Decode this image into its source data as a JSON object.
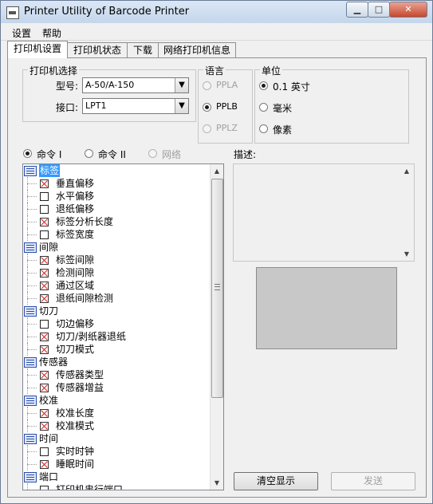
{
  "window": {
    "title": "Printer Utility of Barcode Printer",
    "minimize_glyph": "▁",
    "maximize_glyph": "□",
    "close_glyph": "✕"
  },
  "menu": {
    "items": [
      "设置",
      "帮助"
    ]
  },
  "tabs": [
    {
      "label": "打印机设置",
      "active": true
    },
    {
      "label": "打印机状态",
      "active": false
    },
    {
      "label": "下载",
      "active": false
    },
    {
      "label": "网络打印机信息",
      "active": false
    }
  ],
  "printer_select": {
    "title": "打印机选择",
    "model_label": "型号:",
    "model_value": "A-50/A-150",
    "port_label": "接口:",
    "port_value": "LPT1",
    "dropdown_glyph": "▼"
  },
  "language": {
    "title": "语言",
    "options": [
      {
        "label": "PPLA",
        "selected": false,
        "enabled": false
      },
      {
        "label": "PPLB",
        "selected": true,
        "enabled": true
      },
      {
        "label": "PPLZ",
        "selected": false,
        "enabled": false
      }
    ]
  },
  "unit": {
    "title": "单位",
    "options": [
      {
        "label": "0.1 英寸",
        "selected": true
      },
      {
        "label": "毫米",
        "selected": false
      },
      {
        "label": "像素",
        "selected": false
      }
    ]
  },
  "command_mode": {
    "options": [
      {
        "label": "命令 I",
        "selected": true,
        "enabled": true
      },
      {
        "label": "命令 II",
        "selected": false,
        "enabled": true
      },
      {
        "label": "网络",
        "selected": false,
        "enabled": false
      }
    ]
  },
  "description_label": "描述:",
  "scroll": {
    "up": "▲",
    "down": "▼"
  },
  "tree": [
    {
      "label": "标签",
      "selected": true,
      "children": [
        {
          "label": "垂直偏移",
          "checked": true
        },
        {
          "label": "水平偏移",
          "checked": false
        },
        {
          "label": "退纸偏移",
          "checked": false
        },
        {
          "label": "标签分析长度",
          "checked": true
        },
        {
          "label": "标签宽度",
          "checked": false
        }
      ]
    },
    {
      "label": "间隙",
      "selected": false,
      "children": [
        {
          "label": "标签间隙",
          "checked": true
        },
        {
          "label": "检测间隙",
          "checked": true
        },
        {
          "label": "通过区域",
          "checked": true
        },
        {
          "label": "退纸间隙检测",
          "checked": true
        }
      ]
    },
    {
      "label": "切刀",
      "selected": false,
      "children": [
        {
          "label": "切边偏移",
          "checked": false
        },
        {
          "label": "切刀/剥纸器退纸",
          "checked": true
        },
        {
          "label": "切刀模式",
          "checked": true
        }
      ]
    },
    {
      "label": "传感器",
      "selected": false,
      "children": [
        {
          "label": "传感器类型",
          "checked": true
        },
        {
          "label": "传感器增益",
          "checked": true
        }
      ]
    },
    {
      "label": "校准",
      "selected": false,
      "children": [
        {
          "label": "校准长度",
          "checked": true
        },
        {
          "label": "校准模式",
          "checked": true
        }
      ]
    },
    {
      "label": "时间",
      "selected": false,
      "children": [
        {
          "label": "实时时钟",
          "checked": false
        },
        {
          "label": "睡眠时间",
          "checked": true
        }
      ]
    },
    {
      "label": "端口",
      "selected": false,
      "children": [
        {
          "label": "打印机串行端口",
          "checked": false
        }
      ]
    }
  ],
  "buttons": {
    "clear": "清空显示",
    "send": "发送"
  }
}
